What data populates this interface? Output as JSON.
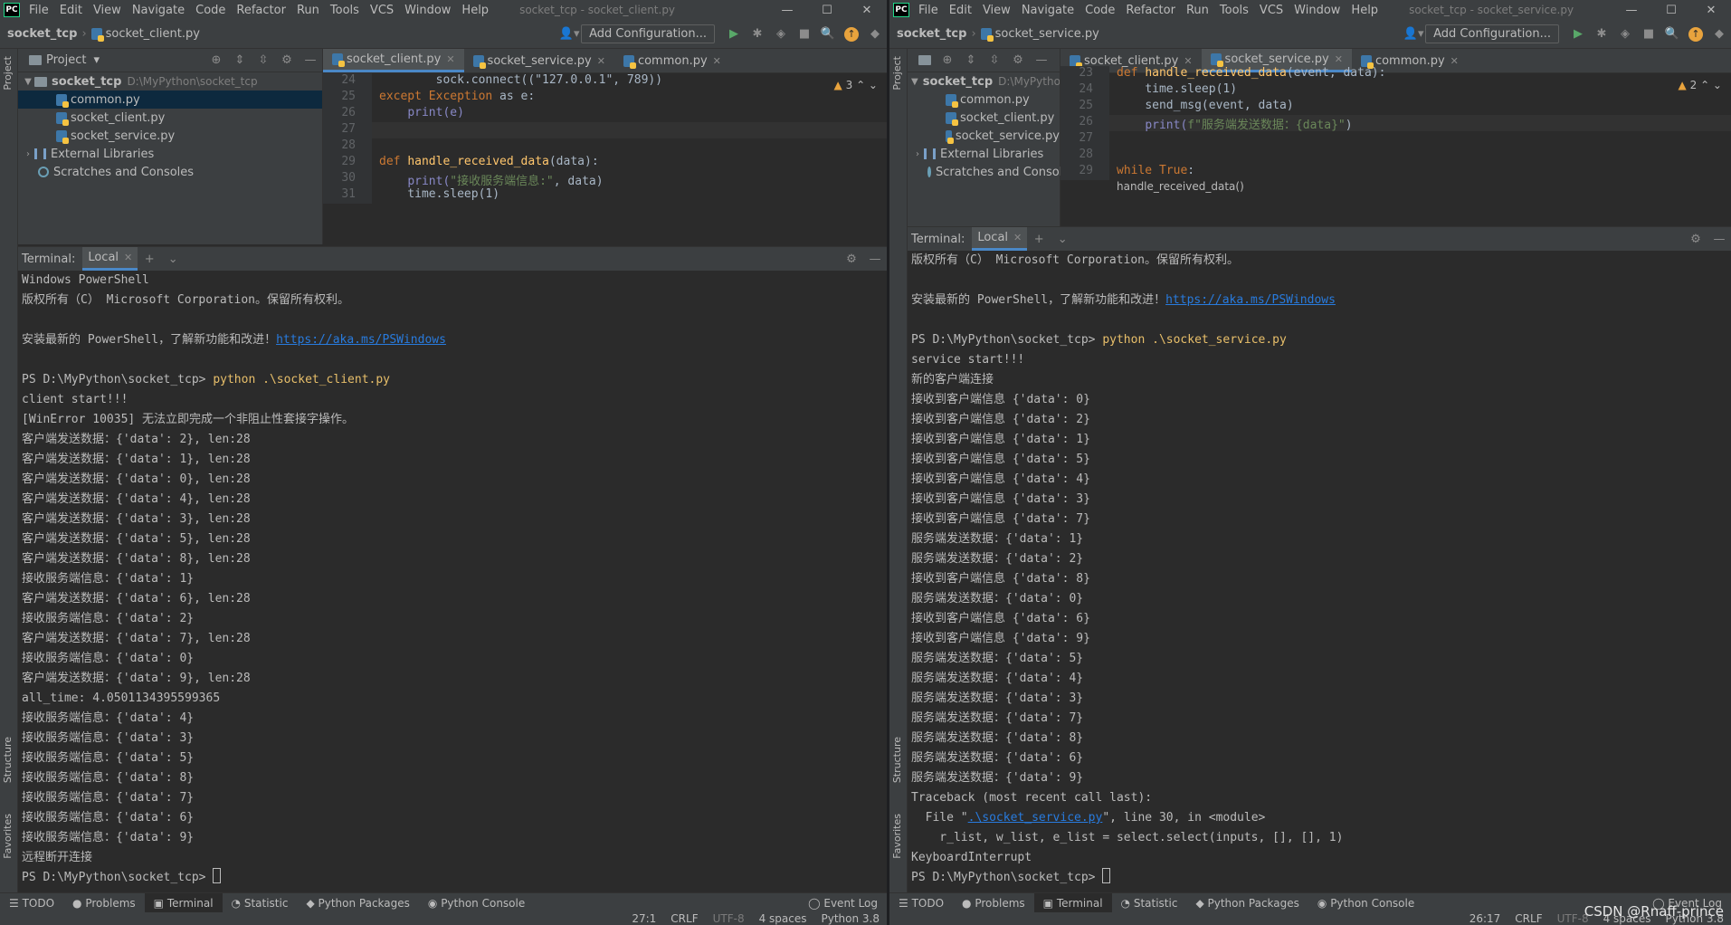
{
  "menu": [
    "File",
    "Edit",
    "View",
    "Navigate",
    "Code",
    "Refactor",
    "Run",
    "Tools",
    "VCS",
    "Window",
    "Help"
  ],
  "logo_text": "PC",
  "left": {
    "window_title": "socket_tcp - socket_client.py",
    "crumb_root": "socket_tcp",
    "crumb_file": "socket_client.py",
    "add_config": "Add Configuration...",
    "project_header": "Project",
    "tree": {
      "root": "socket_tcp",
      "root_path": "D:\\MyPython\\socket_tcp",
      "files": [
        "common.py",
        "socket_client.py",
        "socket_service.py"
      ],
      "ext_libs": "External Libraries",
      "scratches": "Scratches and Consoles"
    },
    "tabs": [
      "socket_client.py",
      "socket_service.py",
      "common.py"
    ],
    "inspection_count": "3",
    "code": {
      "l24": "24",
      "l24_text": "        sock.connect((\"127.0.0.1\", 789))",
      "l25": "25",
      "l25_kw": "except Exception",
      "l25_rest": " as e:",
      "l26": "26",
      "l26_text": "print(e)",
      "l27": "27",
      "l28": "28",
      "l29": "29",
      "l29_kw": "def ",
      "l29_fn": "handle_received_data",
      "l29_rest": "(data):",
      "l30": "30",
      "l30_fn": "print(",
      "l30_str": "\"接收服务端信息:\"",
      "l30_rest": ", data)",
      "l31": "31",
      "l31_text": "time.sleep(1)"
    },
    "terminal_title": "Terminal:",
    "terminal_tab": "Local",
    "terminal_lines": [
      "Windows PowerShell",
      "版权所有（C） Microsoft Corporation。保留所有权利。",
      "",
      "安装最新的 PowerShell，了解新功能和改进！",
      "",
      "PS D:\\MyPython\\socket_tcp> ",
      "client start!!!",
      "[WinError 10035] 无法立即完成一个非阻止性套接字操作。",
      "客户端发送数据：{'data': 2}, len:28",
      "客户端发送数据：{'data': 1}, len:28",
      "客户端发送数据：{'data': 0}, len:28",
      "客户端发送数据：{'data': 4}, len:28",
      "客户端发送数据：{'data': 3}, len:28",
      "客户端发送数据：{'data': 5}, len:28",
      "客户端发送数据：{'data': 8}, len:28",
      "接收服务端信息：{'data': 1}",
      "客户端发送数据：{'data': 6}, len:28",
      "接收服务端信息：{'data': 2}",
      "客户端发送数据：{'data': 7}, len:28",
      "接收服务端信息：{'data': 0}",
      "客户端发送数据：{'data': 9}, len:28",
      "all_time: 4.0501134395599365",
      "接收服务端信息：{'data': 4}",
      "接收服务端信息：{'data': 3}",
      "接收服务端信息：{'data': 5}",
      "接收服务端信息：{'data': 8}",
      "接收服务端信息：{'data': 7}",
      "接收服务端信息：{'data': 6}",
      "接收服务端信息：{'data': 9}",
      "远程断开连接",
      "PS D:\\MyPython\\socket_tcp> "
    ],
    "link": "https://aka.ms/PSWindows",
    "command": "python .\\socket_client.py",
    "bottom_tools": [
      "TODO",
      "Problems",
      "Terminal",
      "Statistic",
      "Python Packages",
      "Python Console",
      "Event Log"
    ],
    "status": [
      "27:1",
      "CRLF",
      "UTF-8",
      "4 spaces",
      "Python 3.8"
    ]
  },
  "right": {
    "window_title": "socket_tcp - socket_service.py",
    "crumb_root": "socket_tcp",
    "crumb_file": "socket_service.py",
    "add_config": "Add Configuration...",
    "tree": {
      "root": "socket_tcp",
      "root_path": "D:\\MyPython",
      "files": [
        "common.py",
        "socket_client.py",
        "socket_service.py"
      ],
      "ext_libs": "External Libraries",
      "scratches": "Scratches and Consoles"
    },
    "tabs": [
      "socket_client.py",
      "socket_service.py",
      "common.py"
    ],
    "inspection_count": "2",
    "code": {
      "l23": "23",
      "l23_kw": "def ",
      "l23_fn": "handle_received_data",
      "l23_rest": "(event, data):",
      "l24": "24",
      "l24_text": "time.sleep(1)",
      "l25": "25",
      "l25_text": "send_msg(event, data)",
      "l26": "26",
      "l26_fn": "print(",
      "l26_str": "f\"服务端发送数据：{data}\"",
      "l26_rest": ")",
      "l27": "27",
      "l28": "28",
      "l29": "29",
      "l29_kw": "while True",
      "l29_rest": ":",
      "hint": "handle_received_data()"
    },
    "terminal_title": "Terminal:",
    "terminal_tab": "Local",
    "terminal_lines": [
      "版权所有（C） Microsoft Corporation。保留所有权利。",
      "",
      "安装最新的 PowerShell，了解新功能和改进！",
      "",
      "PS D:\\MyPython\\socket_tcp> ",
      "service start!!!",
      "新的客户端连接",
      "接收到客户端信息 {'data': 0}",
      "接收到客户端信息 {'data': 2}",
      "接收到客户端信息 {'data': 1}",
      "接收到客户端信息 {'data': 5}",
      "接收到客户端信息 {'data': 4}",
      "接收到客户端信息 {'data': 3}",
      "接收到客户端信息 {'data': 7}",
      "服务端发送数据：{'data': 1}",
      "服务端发送数据：{'data': 2}",
      "接收到客户端信息 {'data': 8}",
      "服务端发送数据：{'data': 0}",
      "接收到客户端信息 {'data': 6}",
      "接收到客户端信息 {'data': 9}",
      "服务端发送数据：{'data': 5}",
      "服务端发送数据：{'data': 4}",
      "服务端发送数据：{'data': 3}",
      "服务端发送数据：{'data': 7}",
      "服务端发送数据：{'data': 8}",
      "服务端发送数据：{'data': 6}",
      "服务端发送数据：{'data': 9}",
      "Traceback (most recent call last):",
      "  File \"",
      "    r_list, w_list, e_list = select.select(inputs, [], [], 1)",
      "KeyboardInterrupt",
      "PS D:\\MyPython\\socket_tcp> "
    ],
    "link": "https://aka.ms/PSWindows",
    "command": "python .\\socket_service.py",
    "traceback_file": ".\\socket_service.py",
    "traceback_rest": "\", line 30, in <module>",
    "bottom_tools": [
      "TODO",
      "Problems",
      "Terminal",
      "Statistic",
      "Python Packages",
      "Python Console",
      "Event Log"
    ],
    "status": [
      "26:17",
      "CRLF",
      "UTF-8",
      "4 spaces",
      "Python 3.8"
    ]
  },
  "watermark": "CSDN @Rnaff-prince"
}
